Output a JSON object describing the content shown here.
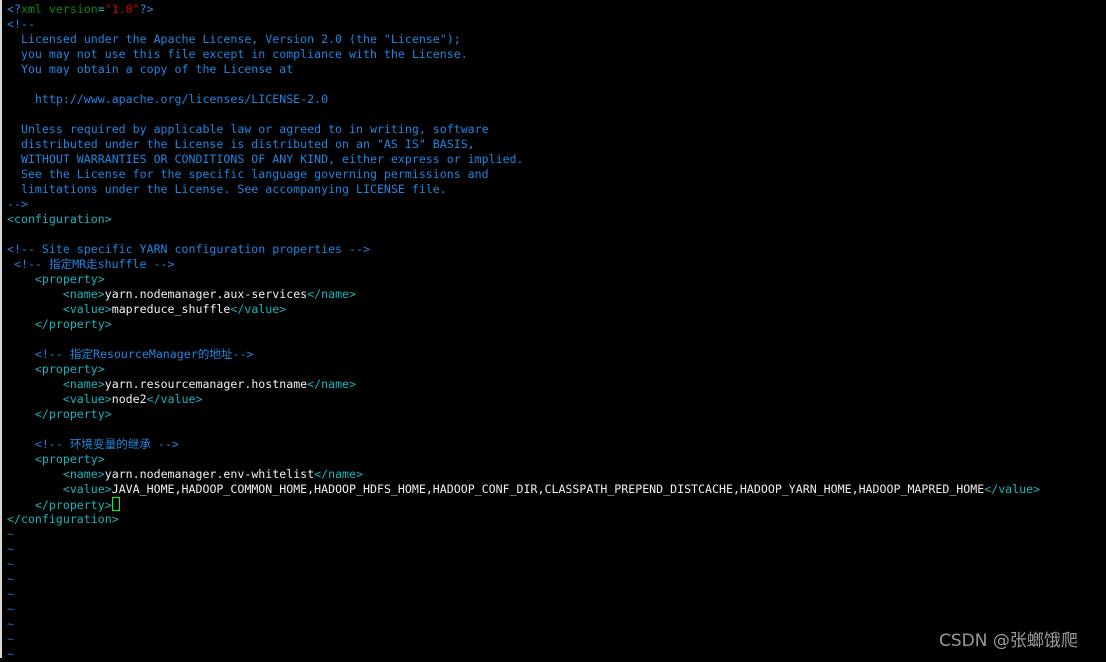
{
  "editor": {
    "lines": [
      [
        [
          "pi",
          "<?"
        ],
        [
          "g",
          "xml version"
        ],
        [
          "eq",
          "="
        ],
        [
          "r",
          "\"1.0\""
        ],
        [
          "pi",
          "?>"
        ]
      ],
      [
        [
          "c",
          "<!--"
        ]
      ],
      [
        [
          "c",
          "  Licensed under the Apache License, Version 2.0 (the \"License\");"
        ]
      ],
      [
        [
          "c",
          "  you may not use this file except in compliance with the License."
        ]
      ],
      [
        [
          "c",
          "  You may obtain a copy of the License at"
        ]
      ],
      [
        [
          "c",
          ""
        ]
      ],
      [
        [
          "c",
          "    http://www.apache.org/licenses/LICENSE-2.0"
        ]
      ],
      [
        [
          "c",
          ""
        ]
      ],
      [
        [
          "c",
          "  Unless required by applicable law or agreed to in writing, software"
        ]
      ],
      [
        [
          "c",
          "  distributed under the License is distributed on an \"AS IS\" BASIS,"
        ]
      ],
      [
        [
          "c",
          "  WITHOUT WARRANTIES OR CONDITIONS OF ANY KIND, either express or implied."
        ]
      ],
      [
        [
          "c",
          "  See the License for the specific language governing permissions and"
        ]
      ],
      [
        [
          "c",
          "  limitations under the License. See accompanying LICENSE file."
        ]
      ],
      [
        [
          "c",
          "-->"
        ]
      ],
      [
        [
          "t",
          "<configuration>"
        ]
      ],
      [
        [
          "x",
          ""
        ]
      ],
      [
        [
          "c",
          "<!-- Site specific YARN configuration properties -->"
        ]
      ],
      [
        [
          "c",
          " <!-- 指定MR走shuffle -->"
        ]
      ],
      [
        [
          "x",
          "    "
        ],
        [
          "t",
          "<property>"
        ]
      ],
      [
        [
          "x",
          "        "
        ],
        [
          "t",
          "<name>"
        ],
        [
          "x",
          "yarn.nodemanager.aux-services"
        ],
        [
          "t",
          "</name>"
        ]
      ],
      [
        [
          "x",
          "        "
        ],
        [
          "t",
          "<value>"
        ],
        [
          "x",
          "mapreduce_shuffle"
        ],
        [
          "t",
          "</value>"
        ]
      ],
      [
        [
          "x",
          "    "
        ],
        [
          "t",
          "</property>"
        ]
      ],
      [
        [
          "x",
          ""
        ]
      ],
      [
        [
          "x",
          "    "
        ],
        [
          "c",
          "<!-- 指定ResourceManager的地址-->"
        ]
      ],
      [
        [
          "x",
          "    "
        ],
        [
          "t",
          "<property>"
        ]
      ],
      [
        [
          "x",
          "        "
        ],
        [
          "t",
          "<name>"
        ],
        [
          "x",
          "yarn.resourcemanager.hostname"
        ],
        [
          "t",
          "</name>"
        ]
      ],
      [
        [
          "x",
          "        "
        ],
        [
          "t",
          "<value>"
        ],
        [
          "x",
          "node2"
        ],
        [
          "t",
          "</value>"
        ]
      ],
      [
        [
          "x",
          "    "
        ],
        [
          "t",
          "</property>"
        ]
      ],
      [
        [
          "x",
          ""
        ]
      ],
      [
        [
          "x",
          "    "
        ],
        [
          "c",
          "<!-- 环境变量的继承 -->"
        ]
      ],
      [
        [
          "x",
          "    "
        ],
        [
          "t",
          "<property>"
        ]
      ],
      [
        [
          "x",
          "        "
        ],
        [
          "t",
          "<name>"
        ],
        [
          "x",
          "yarn.nodemanager.env-whitelist"
        ],
        [
          "t",
          "</name>"
        ]
      ],
      [
        [
          "x",
          "        "
        ],
        [
          "t",
          "<value>"
        ],
        [
          "x",
          "JAVA_HOME,HADOOP_COMMON_HOME,HADOOP_HDFS_HOME,HADOOP_CONF_DIR,CLASSPATH_PREPEND_DISTCACHE,HADOOP_YARN_HOME,HADOOP_MAPRED_HOME"
        ],
        [
          "t",
          "</value>"
        ]
      ],
      [
        [
          "x",
          "    "
        ],
        [
          "t",
          "</property>"
        ],
        [
          "cursor",
          ""
        ]
      ],
      [
        [
          "t",
          "</configuration>"
        ]
      ],
      [
        [
          "tilde",
          "~"
        ]
      ],
      [
        [
          "tilde",
          "~"
        ]
      ],
      [
        [
          "tilde",
          "~"
        ]
      ],
      [
        [
          "tilde",
          "~"
        ]
      ],
      [
        [
          "tilde",
          "~"
        ]
      ],
      [
        [
          "tilde",
          "~"
        ]
      ],
      [
        [
          "tilde",
          "~"
        ]
      ],
      [
        [
          "tilde",
          "~"
        ]
      ],
      [
        [
          "tilde",
          "~"
        ]
      ]
    ]
  },
  "watermark": "CSDN @张螂饿爬",
  "colors": {
    "background": "#000000",
    "comment": "#1f86e0",
    "tag": "#18b4bd",
    "text": "#e4e4e4",
    "cursor": "#00ff00"
  }
}
